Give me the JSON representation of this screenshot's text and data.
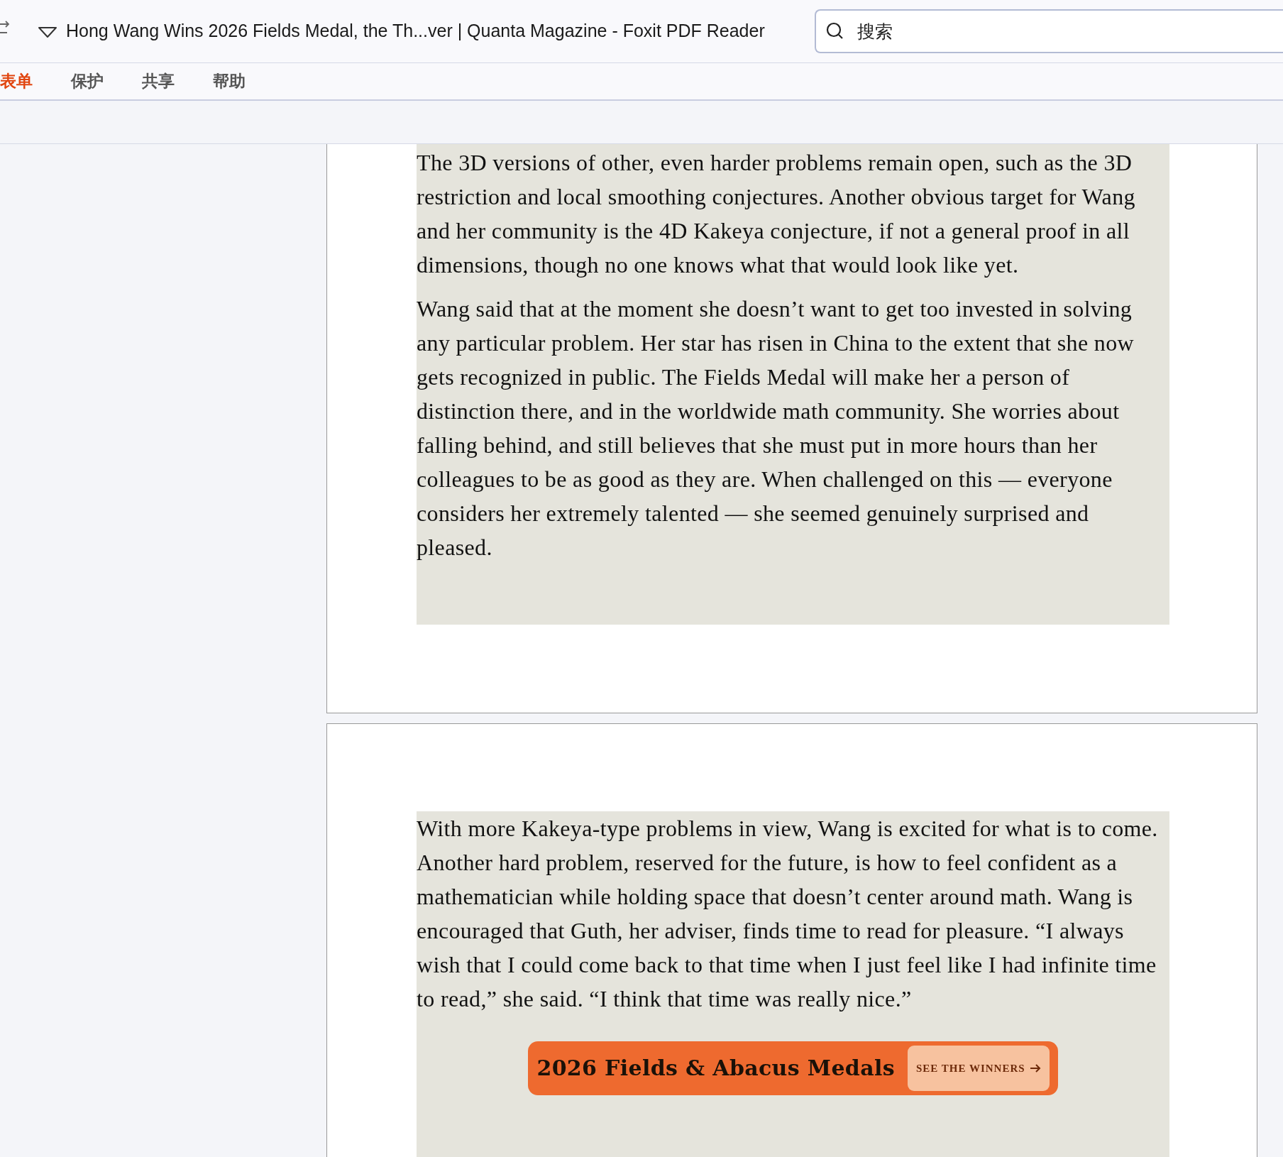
{
  "window": {
    "title": "Hong Wang Wins 2026 Fields Medal, the Th...ver | Quanta Magazine - Foxit PDF Reader"
  },
  "search": {
    "placeholder": "搜索"
  },
  "menu": [
    {
      "label": "表单",
      "selected": true
    },
    {
      "label": "保护",
      "selected": false
    },
    {
      "label": "共享",
      "selected": false
    },
    {
      "label": "帮助",
      "selected": false
    }
  ],
  "pages": [
    {
      "paragraphs": [
        "The 3D versions of other, even harder problems remain open, such as the 3D restriction and local smoothing conjectures. Another obvious target for Wang and her community is the 4D Kakeya conjecture, if not a general proof in all dimensions, though no one knows what that would look like yet.",
        "Wang said that at the moment she doesn’t want to get too invested in solving any particular problem. Her star has risen in China to the extent that she now gets recognized in public. The Fields Medal will make her a person of distinction there, and in the worldwide math community. She worries about falling behind, and still believes that she must put in more hours than her colleagues to be as good as they are. When challenged on this — everyone considers her extremely talented — she seemed genuinely surprised and pleased."
      ]
    },
    {
      "paragraphs": [
        "With more Kakeya-type problems in view, Wang is excited for what is to come. Another hard problem, reserved for the future, is how to feel confident as a mathematician while holding space that doesn’t center around math. Wang is encouraged that Guth, her adviser, finds time to read for pleasure. “I always wish that I could come back to that time when I just feel like I had infinite time to read,” she said. “I think that time was really nice.”"
      ],
      "banner": {
        "title": "2026 Fields & Abacus Medals",
        "button": "SEE THE WINNERS"
      }
    }
  ]
}
